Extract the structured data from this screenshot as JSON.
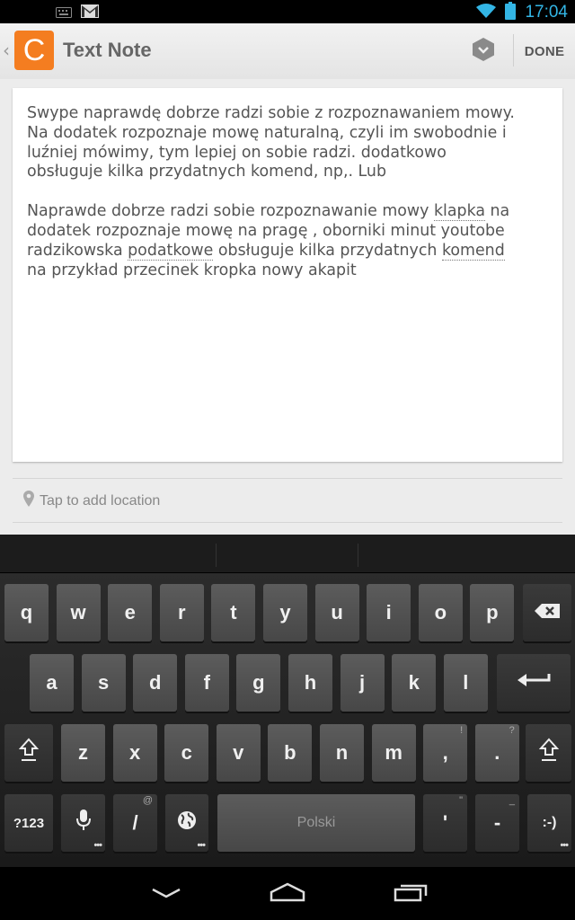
{
  "status_bar": {
    "time": "17:04",
    "icons": [
      "keyboard-icon",
      "gmail-icon",
      "wifi-icon",
      "battery-icon"
    ],
    "accent_color": "#33b5e5"
  },
  "action_bar": {
    "logo_letter": "C",
    "title": "Text Note",
    "done_label": "DONE",
    "brand_color": "#f47d20"
  },
  "note": {
    "paragraph1": "Swype naprawdę dobrze radzi sobie z rozpoznawaniem mowy. Na dodatek rozpoznaje mowę naturalną, czyli im swobodnie i luźniej mówimy, tym lepiej on sobie radzi. dodatkowo obsługuje kilka przydatnych komend, np,. Lub",
    "p2": {
      "s1": "Naprawde dobrze radzi sobie rozpoznawanie mowy ",
      "u1": "klapka",
      "s2": " na dodatek rozpoznaje mowę na pragę , oborniki minut youtobe radzikowska ",
      "u2": "podatkowe",
      "s3": " obsługuje kilka przydatnych ",
      "u3": "komend",
      "s4": " na przykład przecinek kropka nowy akapit"
    }
  },
  "location": {
    "placeholder": "Tap to add location"
  },
  "keyboard": {
    "row1": [
      "q",
      "w",
      "e",
      "r",
      "t",
      "y",
      "u",
      "i",
      "o",
      "p"
    ],
    "row2": [
      "a",
      "s",
      "d",
      "f",
      "g",
      "h",
      "j",
      "k",
      "l"
    ],
    "row3": [
      "z",
      "x",
      "c",
      "v",
      "b",
      "n",
      "m",
      ",",
      "."
    ],
    "row3_hints": {
      "comma": "!",
      "period": "?"
    },
    "symbols_label": "?123",
    "slash_label": "/",
    "slash_hint": "@",
    "space_label": "Polski",
    "apostrophe_label": "'",
    "apostrophe_hint": "\"",
    "dash_label": "-",
    "dash_hint": "_",
    "smiley_label": ":-)"
  },
  "nav_bar": {
    "buttons": [
      "back-icon",
      "home-icon",
      "recents-icon"
    ]
  }
}
